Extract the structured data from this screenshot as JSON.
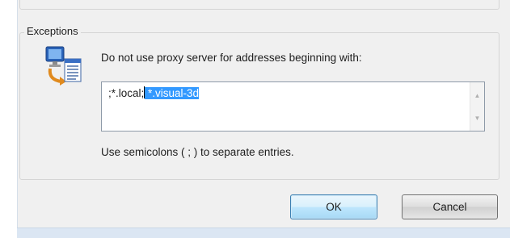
{
  "exceptions": {
    "group_title": "Exceptions",
    "instruction": "Do not use proxy server for addresses beginning with:",
    "textarea": {
      "value_plain": ";*.local;",
      "value_selected": " *.visual-3d"
    },
    "hint": "Use semicolons ( ; ) to separate entries."
  },
  "buttons": {
    "ok": "OK",
    "cancel": "Cancel"
  },
  "icons": {
    "exceptions_icon": "computer-network-icon"
  }
}
